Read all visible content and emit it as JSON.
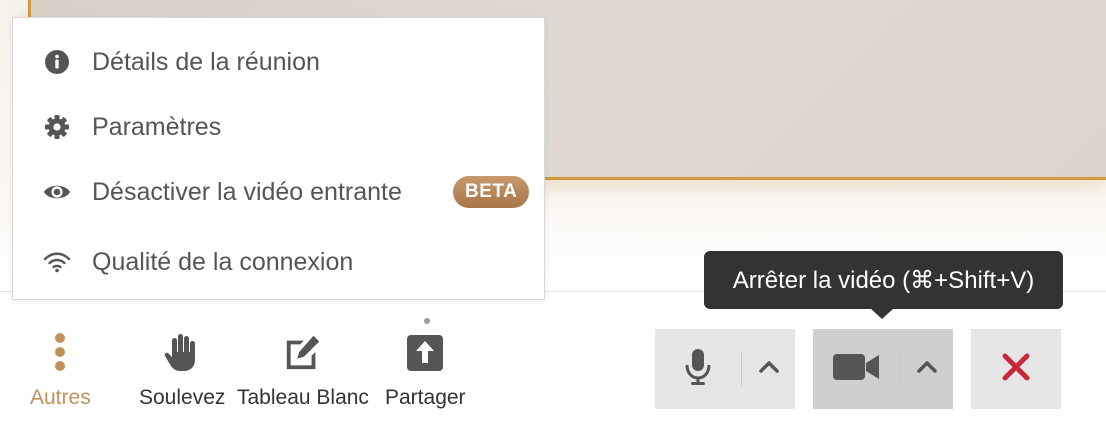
{
  "menu": {
    "items": [
      {
        "label": "Détails de la réunion",
        "icon": "info-icon"
      },
      {
        "label": "Paramètres",
        "icon": "gear-icon"
      },
      {
        "label": "Désactiver la vidéo entrante",
        "icon": "eye-icon",
        "badge": "BETA"
      },
      {
        "label": "Qualité de la connexion",
        "icon": "wifi-icon"
      }
    ]
  },
  "tooltip": "Arrêter la vidéo (⌘+Shift+V)",
  "toolbar": {
    "more_label": "Autres",
    "raise_hand_label": "Soulevez",
    "whiteboard_label": "Tableau Blanc",
    "share_label": "Partager"
  },
  "colors": {
    "accent": "#c1915c",
    "leave": "#c7283d",
    "icon": "#555555"
  }
}
